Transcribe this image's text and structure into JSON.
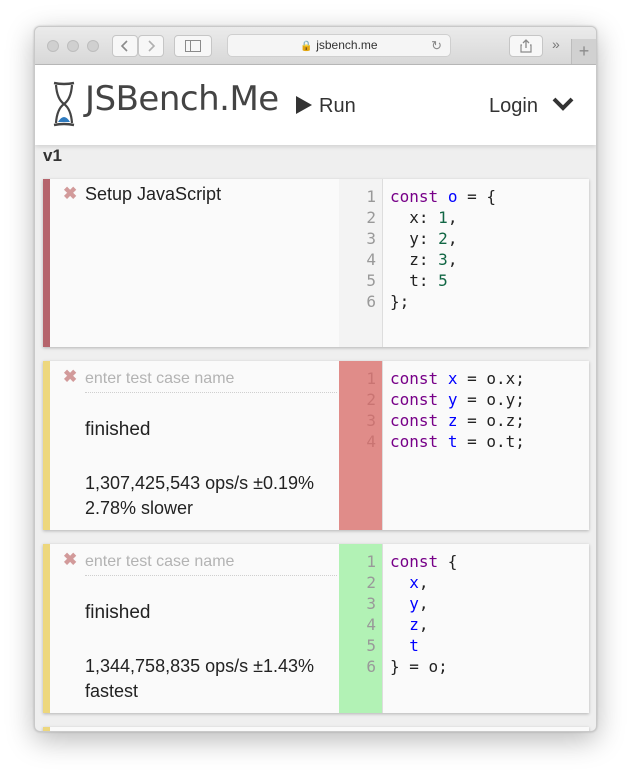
{
  "browser": {
    "url": "jsbench.me",
    "lock_icon": "lock-icon",
    "new_tab_label": "+"
  },
  "header": {
    "logo_text": "JSBench.Me",
    "run_label": "Run",
    "login_label": "Login"
  },
  "version_label": "v1",
  "setup": {
    "title": "Setup JavaScript",
    "accent_color": "#b5646c",
    "line_numbers": [
      "1",
      "2",
      "3",
      "4",
      "5",
      "6"
    ],
    "code_lines": [
      [
        {
          "t": "const",
          "c": "kw"
        },
        {
          "t": " "
        },
        {
          "t": "o",
          "c": "var"
        },
        {
          "t": " = {"
        }
      ],
      [
        {
          "t": "  x: "
        },
        {
          "t": "1",
          "c": "num"
        },
        {
          "t": ","
        }
      ],
      [
        {
          "t": "  y: "
        },
        {
          "t": "2",
          "c": "num"
        },
        {
          "t": ","
        }
      ],
      [
        {
          "t": "  z: "
        },
        {
          "t": "3",
          "c": "num"
        },
        {
          "t": ","
        }
      ],
      [
        {
          "t": "  t: "
        },
        {
          "t": "5",
          "c": "num"
        }
      ],
      [
        {
          "t": "};"
        }
      ]
    ]
  },
  "test_cases": [
    {
      "name_placeholder": "enter test case name",
      "status": "finished",
      "ops": "1,307,425,543 ops/s ±0.19%",
      "comparison": "2.78% slower",
      "accent_color": "#edd77d",
      "gutter_color": "#e08c89",
      "gutter_text_color": "#c97472",
      "line_numbers": [
        "1",
        "2",
        "3",
        "4"
      ],
      "code_lines": [
        [
          {
            "t": "const",
            "c": "kw"
          },
          {
            "t": " "
          },
          {
            "t": "x",
            "c": "var"
          },
          {
            "t": " = o.x;"
          }
        ],
        [
          {
            "t": "const",
            "c": "kw"
          },
          {
            "t": " "
          },
          {
            "t": "y",
            "c": "var"
          },
          {
            "t": " = o.y;"
          }
        ],
        [
          {
            "t": "const",
            "c": "kw"
          },
          {
            "t": " "
          },
          {
            "t": "z",
            "c": "var"
          },
          {
            "t": " = o.z;"
          }
        ],
        [
          {
            "t": "const",
            "c": "kw"
          },
          {
            "t": " "
          },
          {
            "t": "t",
            "c": "var"
          },
          {
            "t": " = o.t;"
          }
        ]
      ]
    },
    {
      "name_placeholder": "enter test case name",
      "status": "finished",
      "ops": "1,344,758,835 ops/s ±1.43%",
      "comparison": "fastest",
      "accent_color": "#edd77d",
      "gutter_color": "#b2f2b5",
      "gutter_text_color": "#999999",
      "line_numbers": [
        "1",
        "2",
        "3",
        "4",
        "5",
        "6"
      ],
      "code_lines": [
        [
          {
            "t": "const",
            "c": "kw"
          },
          {
            "t": " {"
          }
        ],
        [
          {
            "t": "  "
          },
          {
            "t": "x",
            "c": "var"
          },
          {
            "t": ","
          }
        ],
        [
          {
            "t": "  "
          },
          {
            "t": "y",
            "c": "var"
          },
          {
            "t": ","
          }
        ],
        [
          {
            "t": "  "
          },
          {
            "t": "z",
            "c": "var"
          },
          {
            "t": ","
          }
        ],
        [
          {
            "t": "  "
          },
          {
            "t": "t",
            "c": "var"
          }
        ],
        [
          {
            "t": "} = o;"
          }
        ]
      ]
    }
  ]
}
